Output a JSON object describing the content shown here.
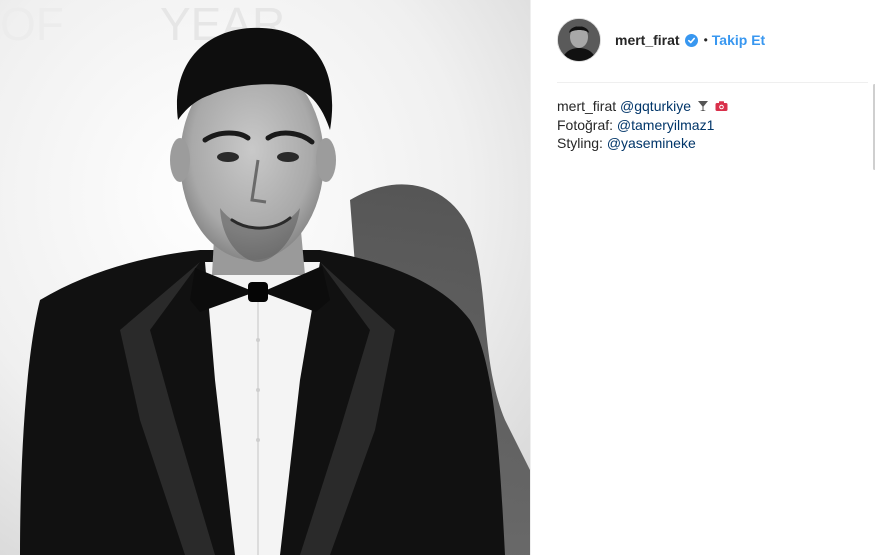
{
  "post": {
    "image_alt": "Black and white portrait of a man in a tuxedo with a bow tie",
    "header": {
      "username": "mert_firat",
      "verified": true,
      "separator": "•",
      "follow_label": "Takip Et"
    },
    "caption": {
      "username": "mert_firat",
      "mention_main": "@gqturkiye",
      "photo_label": "Fotoğraf:",
      "photo_mention": "@tameryilmaz1",
      "styling_label": "Styling:",
      "styling_mention": "@yasemineke",
      "emojis": [
        "cocktail-glass-icon",
        "camera-icon"
      ]
    }
  },
  "colors": {
    "link_blue": "#3897f0",
    "mention_dark": "#003569",
    "text": "#262626"
  }
}
